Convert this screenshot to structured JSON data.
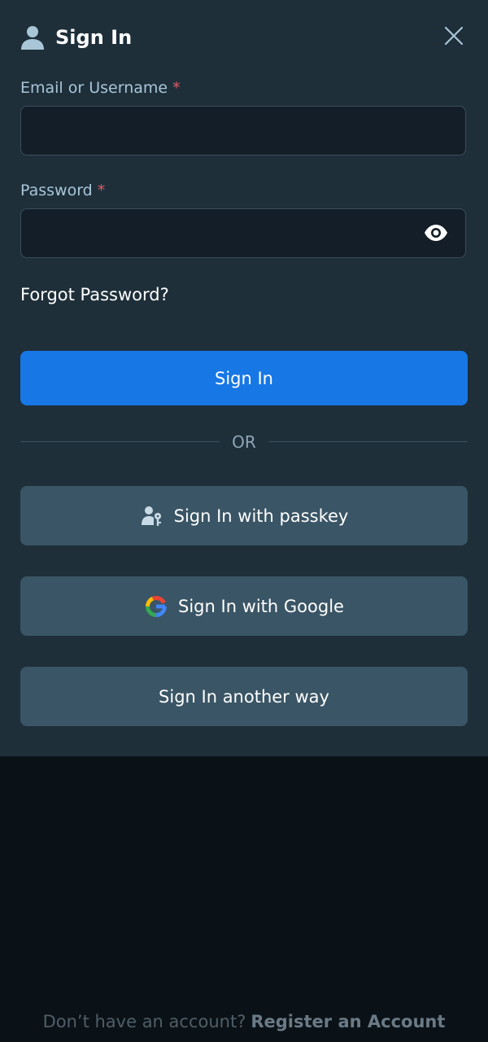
{
  "header": {
    "title": "Sign In",
    "user_icon": "user-icon",
    "close_icon": "close-icon"
  },
  "form": {
    "email_label": "Email or Username",
    "email_value": "",
    "password_label": "Password",
    "password_value": "",
    "required_mark": "*",
    "eye_icon": "eye-icon",
    "forgot_password": "Forgot Password?"
  },
  "buttons": {
    "sign_in": "Sign In",
    "divider": "OR",
    "passkey": "Sign In with passkey",
    "passkey_icon": "passkey-user-icon",
    "google": "Sign In with Google",
    "google_icon": "google-icon",
    "another_way": "Sign In another way"
  },
  "footer": {
    "prompt": "Don’t have an account?",
    "register": "Register an Account"
  },
  "colors": {
    "modal_bg": "#1e2f3a",
    "page_bg": "#0b1217",
    "primary": "#1777e5",
    "secondary": "#3a5565",
    "required": "#e05a66"
  }
}
